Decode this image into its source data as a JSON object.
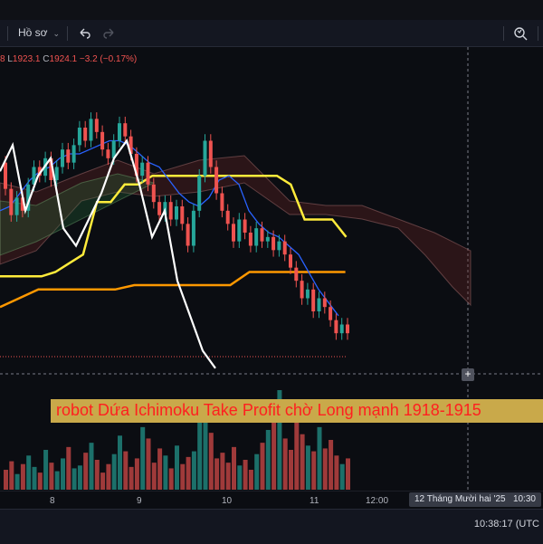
{
  "toolbar": {
    "profile_label": "Hồ sơ",
    "undo_icon": "undo-icon",
    "redo_icon": "redo-icon",
    "snapshot_icon": "camera-icon"
  },
  "legend": {
    "o_tail": "8",
    "l_label": "L",
    "l_value": "1923.1",
    "c_label": "C",
    "c_value": "1924.1",
    "change": "−3.2 (−0.17%)"
  },
  "banner": {
    "text": "robot Dứa Ichimoku Take Profit chờ Long mạnh 1918-1915"
  },
  "time_axis": {
    "labels": [
      "8",
      "9",
      "10",
      "11",
      "12:00"
    ],
    "crosshair_label": "12 Tháng Mười hai '25",
    "crosshair_time": "10:30"
  },
  "status": {
    "clock": "10:38:17 (UTC"
  },
  "colors": {
    "up": "#26a69a",
    "down": "#ef5350",
    "lagging": "#ffffff",
    "kijun_fast": "#ffeb3b",
    "kijun_slow": "#ff9800",
    "tenkan": "#2962ff"
  },
  "chart_data": {
    "type": "candlestick",
    "candles": [
      {
        "o": 1961,
        "c": 1955
      },
      {
        "o": 1955,
        "c": 1949
      },
      {
        "o": 1949,
        "c": 1953
      },
      {
        "o": 1953,
        "c": 1950
      },
      {
        "o": 1950,
        "c": 1956
      },
      {
        "o": 1956,
        "c": 1960
      },
      {
        "o": 1960,
        "c": 1958
      },
      {
        "o": 1958,
        "c": 1962
      },
      {
        "o": 1962,
        "c": 1957
      },
      {
        "o": 1957,
        "c": 1960
      },
      {
        "o": 1960,
        "c": 1964
      },
      {
        "o": 1964,
        "c": 1961
      },
      {
        "o": 1961,
        "c": 1965
      },
      {
        "o": 1965,
        "c": 1969
      },
      {
        "o": 1969,
        "c": 1966
      },
      {
        "o": 1966,
        "c": 1971
      },
      {
        "o": 1971,
        "c": 1968
      },
      {
        "o": 1968,
        "c": 1964
      },
      {
        "o": 1964,
        "c": 1962
      },
      {
        "o": 1962,
        "c": 1966
      },
      {
        "o": 1966,
        "c": 1970
      },
      {
        "o": 1970,
        "c": 1967
      },
      {
        "o": 1967,
        "c": 1963
      },
      {
        "o": 1963,
        "c": 1958
      },
      {
        "o": 1958,
        "c": 1961
      },
      {
        "o": 1961,
        "c": 1956
      },
      {
        "o": 1956,
        "c": 1952
      },
      {
        "o": 1952,
        "c": 1949
      },
      {
        "o": 1949,
        "c": 1952
      },
      {
        "o": 1952,
        "c": 1948
      },
      {
        "o": 1948,
        "c": 1951
      },
      {
        "o": 1951,
        "c": 1947
      },
      {
        "o": 1947,
        "c": 1942
      },
      {
        "o": 1942,
        "c": 1950
      },
      {
        "o": 1950,
        "c": 1958
      },
      {
        "o": 1958,
        "c": 1966
      },
      {
        "o": 1966,
        "c": 1960
      },
      {
        "o": 1960,
        "c": 1954
      },
      {
        "o": 1954,
        "c": 1950
      },
      {
        "o": 1950,
        "c": 1947
      },
      {
        "o": 1947,
        "c": 1943
      },
      {
        "o": 1943,
        "c": 1948
      },
      {
        "o": 1948,
        "c": 1945
      },
      {
        "o": 1945,
        "c": 1942
      },
      {
        "o": 1942,
        "c": 1946
      },
      {
        "o": 1946,
        "c": 1943
      },
      {
        "o": 1943,
        "c": 1944
      },
      {
        "o": 1944,
        "c": 1941
      },
      {
        "o": 1941,
        "c": 1943
      },
      {
        "o": 1943,
        "c": 1940
      },
      {
        "o": 1940,
        "c": 1937
      },
      {
        "o": 1937,
        "c": 1934
      },
      {
        "o": 1934,
        "c": 1930
      },
      {
        "o": 1930,
        "c": 1932
      },
      {
        "o": 1932,
        "c": 1927
      },
      {
        "o": 1927,
        "c": 1930
      },
      {
        "o": 1930,
        "c": 1928
      },
      {
        "o": 1928,
        "c": 1925
      },
      {
        "o": 1925,
        "c": 1922
      },
      {
        "o": 1922,
        "c": 1924
      },
      {
        "o": 1924,
        "c": 1922
      }
    ],
    "volume": [
      14,
      20,
      11,
      18,
      24,
      16,
      12,
      28,
      19,
      13,
      22,
      30,
      15,
      17,
      26,
      33,
      21,
      12,
      18,
      25,
      38,
      27,
      16,
      22,
      44,
      36,
      19,
      29,
      24,
      15,
      31,
      18,
      23,
      27,
      55,
      61,
      40,
      22,
      26,
      19,
      30,
      17,
      21,
      14,
      25,
      33,
      42,
      48,
      70,
      36,
      28,
      52,
      39,
      31,
      27,
      44,
      29,
      35,
      24,
      18,
      22
    ],
    "ichimoku": {
      "tenkan_sen": [
        1950,
        1951,
        1954,
        1957,
        1959,
        1960,
        1962,
        1963,
        1963,
        1964,
        1965,
        1966,
        1966,
        1965,
        1963,
        1961,
        1960,
        1957,
        1954,
        1952,
        1951,
        1953,
        1957,
        1958,
        1956,
        1950,
        1947,
        1945,
        1944,
        1942,
        1940,
        1936,
        1932,
        1929,
        1926
      ],
      "kijun_sen": [
        1935,
        1935,
        1935,
        1935,
        1936,
        1938,
        1940,
        1952,
        1952,
        1956,
        1956,
        1958,
        1958,
        1958,
        1958,
        1958,
        1958,
        1958,
        1958,
        1958,
        1958,
        1956,
        1948,
        1948,
        1948,
        1944
      ],
      "kijun_sen_slow": [
        1928,
        1930,
        1932,
        1932,
        1932,
        1932,
        1932,
        1933,
        1933,
        1933,
        1933,
        1933,
        1933,
        1936,
        1936,
        1936,
        1936,
        1936,
        1936
      ],
      "chikou_span": [
        1959,
        1965,
        1950,
        1958,
        1962,
        1946,
        1942,
        1948,
        1954,
        1962,
        1966,
        1956,
        1944,
        1950,
        1934,
        1926,
        1918,
        1914
      ]
    }
  }
}
